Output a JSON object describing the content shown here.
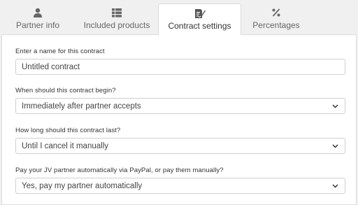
{
  "tabs": [
    {
      "label": "Partner info",
      "icon": "user-icon"
    },
    {
      "label": "Included products",
      "icon": "table-icon"
    },
    {
      "label": "Contract settings",
      "icon": "contract-edit-icon",
      "active": true
    },
    {
      "label": "Percentages",
      "icon": "percent-icon"
    }
  ],
  "form": {
    "name_label": "Enter a name for this contract",
    "name_value": "Untitled contract",
    "begin_label": "When should this contract begin?",
    "begin_value": "Immediately after partner accepts",
    "duration_label": "How long should this contract last?",
    "duration_value": "Until I cancel it manually",
    "payment_label": "Pay your JV partner automatically via PayPal, or pay them manually?",
    "payment_value": "Yes, pay my partner automatically"
  },
  "colors": {
    "background": "#f0f0f0",
    "panel": "#ffffff",
    "icon": "#666666",
    "border": "#cfcfcf"
  }
}
